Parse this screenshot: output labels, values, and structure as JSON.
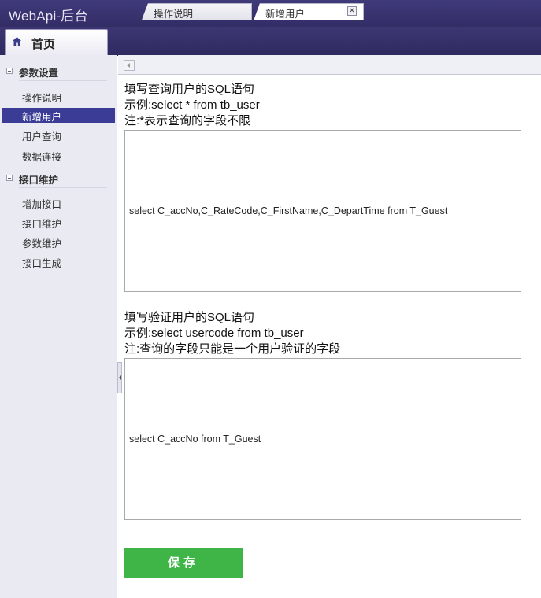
{
  "app": {
    "title": "WebApi-后台"
  },
  "nav": {
    "home_tab_label": "首页"
  },
  "sidebar": {
    "groups": [
      {
        "title": "参数设置",
        "items": [
          "操作说明",
          "新增用户",
          "用户查询",
          "数据连接"
        ]
      },
      {
        "title": "接口维护",
        "items": [
          "增加接口",
          "接口维护",
          "参数维护",
          "接口生成"
        ]
      }
    ],
    "active_item": "新增用户"
  },
  "tabs": [
    {
      "label": "操作说明",
      "active": false
    },
    {
      "label": "新增用户",
      "active": true,
      "close_icon": "×"
    }
  ],
  "query_section": {
    "instruction": "填写查询用户的SQL语句",
    "example": "示例:select * from tb_user",
    "note": "注:*表示查询的字段不限",
    "sql": "select C_accNo,C_RateCode,C_FirstName,C_DepartTime from T_Guest"
  },
  "verify_section": {
    "instruction": "填写验证用户的SQL语句",
    "example": "示例:select usercode from tb_user",
    "note": "注:查询的字段只能是一个用户验证的字段",
    "sql": "select C_accNo from T_Guest"
  },
  "save_button": {
    "label": "保存"
  },
  "colors": {
    "header": "#3a3574",
    "active_sidebar": "#3a3c96",
    "save_button": "#3fb548"
  },
  "icons": {
    "home": "home-icon",
    "collapse": "collapse-arrow-icon"
  }
}
